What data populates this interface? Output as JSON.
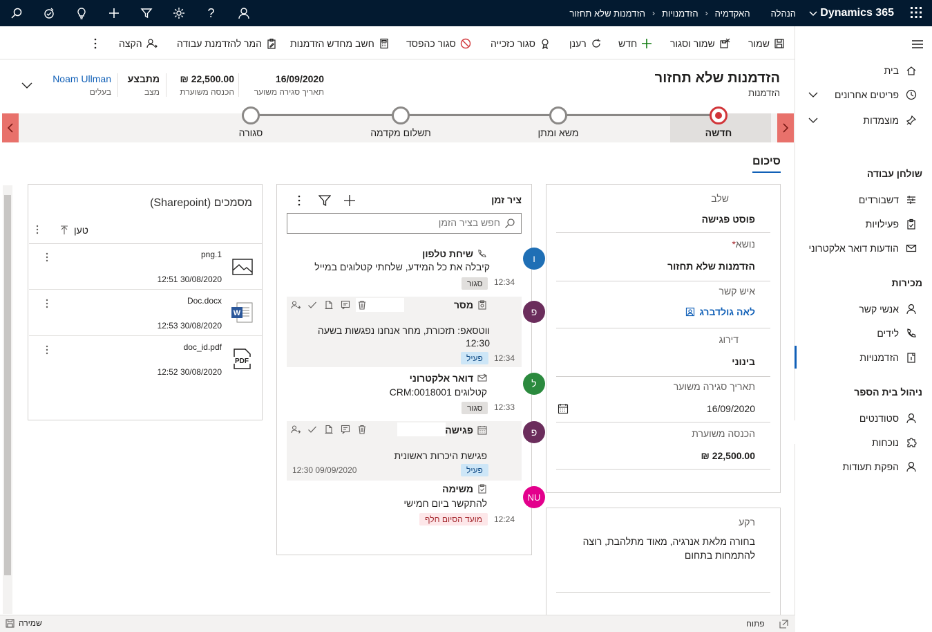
{
  "topbar": {
    "brand": "Dynamics 365",
    "breadcrumb": [
      "הנהלה",
      "האקדמיה",
      "הזדמנויות",
      "הזדמנות שלא תחזור"
    ]
  },
  "nav": {
    "home": "בית",
    "recent": "פריטים אחרונים",
    "pinned": "מוצמדות",
    "groups": {
      "workspace": "שולחן עבודה",
      "sales": "מכירות",
      "school": "ניהול בית הספר"
    },
    "workspace_items": [
      "דשבורדים",
      "פעילויות",
      "הודעות דואר אלקטרוני"
    ],
    "sales_items": [
      "אנשי קשר",
      "לידים",
      "הזדמנויות"
    ],
    "school_items": [
      "סטודנטים",
      "נוכחות",
      "הפקת תעודות"
    ]
  },
  "commands": {
    "save": "שמור",
    "save_close": "שמור וסגור",
    "new": "חדש",
    "refresh": "רענן",
    "close_won": "סגור כזכייה",
    "close_lost": "סגור כהפסד",
    "recalc": "חשב מחדש הזדמנות",
    "to_work_order": "המר להזדמנת עבודה",
    "assign": "הקצה"
  },
  "header": {
    "title": "הזדמנות שלא תחזור",
    "entity": "הזדמנות",
    "fields": [
      {
        "value": "16/09/2020",
        "label": "תאריך סגירה משוער"
      },
      {
        "value": "22,500.00 ₪",
        "label": "הכנסה משוערת"
      },
      {
        "value": "מתבצע",
        "label": "מצב"
      },
      {
        "value": "Noam Ullman",
        "label": "בעלים"
      }
    ]
  },
  "bpf": {
    "stages": [
      "חדשה",
      "משא ומתן",
      "תשלום מקדמה",
      "סגורה"
    ],
    "current": 0
  },
  "tab": {
    "summary": "סיכום"
  },
  "summary": {
    "stage_label": "שלב",
    "stage_value": "פוסט פגישה",
    "topic_label": "נושא",
    "topic_value": "הזדמנות שלא תחזור",
    "contact_label": "איש קשר",
    "contact_value": "לאה גולדברג",
    "rating_label": "דירוג",
    "rating_value": "בינוני",
    "close_date_label": "תאריך סגירה משוער",
    "close_date_value": "16/09/2020",
    "revenue_label": "הכנסה משוערת",
    "revenue_value": "22,500.00 ₪"
  },
  "background": {
    "label": "רקע",
    "value": "בחורה מלאת אנרגיה, מאוד מתלהבת, רוצה להתמחות בתחום"
  },
  "timeline": {
    "title": "ציר זמן",
    "search_placeholder": "חפש בציר הזמן",
    "items": [
      {
        "initial": "ו",
        "color": "#1f6fb5",
        "type": "שיחת טלפון",
        "desc": "קיבלה את כל המידע, שלחתי קטלוגים במייל",
        "time": "12:34",
        "status": "סגור"
      },
      {
        "initial": "פ",
        "color": "#6b2d5c",
        "type": "מסר",
        "desc": "ווטסאפ: תזכורת, מחר אנחנו נפגשות בשעה 12:30",
        "time": "12:34",
        "status": "פעיל"
      },
      {
        "initial": "ל",
        "color": "#2b8a3e",
        "type": "דואר אלקטרוני",
        "desc": "קטלוגים CRM:0018001",
        "time": "12:33",
        "status": "סגור"
      },
      {
        "initial": "פ",
        "color": "#6b2d5c",
        "type": "פגישה",
        "desc": "פגישת היכרות ראשונית",
        "time": "12:30 09/09/2020",
        "status": "פעיל"
      },
      {
        "initial": "NU",
        "color": "#e3008c",
        "type": "משימה",
        "desc": "להתקשר ביום חמישי",
        "time": "12:24",
        "status": "מועד הסיום חלף"
      }
    ]
  },
  "documents": {
    "title": "מסמכים (Sharepoint)",
    "col_loaded": "טען",
    "files": [
      {
        "name": "png.1",
        "date": "12:51 30/08/2020"
      },
      {
        "name": "Doc.docx",
        "date": "12:53 30/08/2020"
      },
      {
        "name": "doc_id.pdf",
        "date": "12:52 30/08/2020"
      }
    ]
  },
  "statusbar": {
    "save": "שמירה",
    "open": "פתוח"
  }
}
